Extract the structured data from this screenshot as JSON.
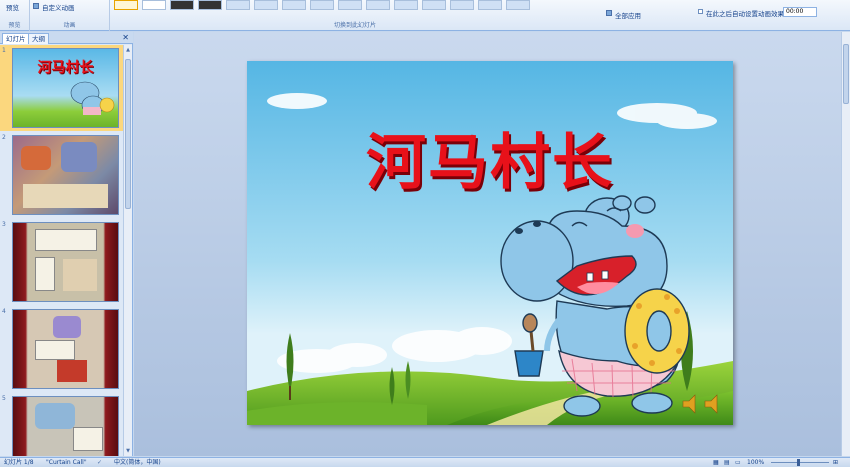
{
  "ribbon": {
    "preview_label": "预览",
    "preview_group": "预览",
    "custom_animation_label": "自定义动画",
    "animation_group": "动画",
    "transition_group": "切换到此幻灯片",
    "apply_all_label": "全部应用",
    "auto_advance_label": "在此之后自动设置动画效果:",
    "auto_advance_value": "00:00"
  },
  "panel": {
    "tab_slides": "幻灯片",
    "tab_outline": "大纲",
    "close_symbol": "✕",
    "slides": [
      {
        "num": "1",
        "title": "河马村长"
      },
      {
        "num": "2"
      },
      {
        "num": "3"
      },
      {
        "num": "4"
      },
      {
        "num": "5"
      }
    ]
  },
  "slide": {
    "title": "河马村长"
  },
  "status": {
    "slide_info": "幻灯片 1/8",
    "theme": "\"Curtain Call\"",
    "language": "中文(简体，中国)",
    "zoom": "100%"
  },
  "colors": {
    "title_red": "#e8111a",
    "sky_top": "#6fc3ea",
    "grass": "#7cc22e",
    "hippo_blue": "#8fc6e8"
  }
}
